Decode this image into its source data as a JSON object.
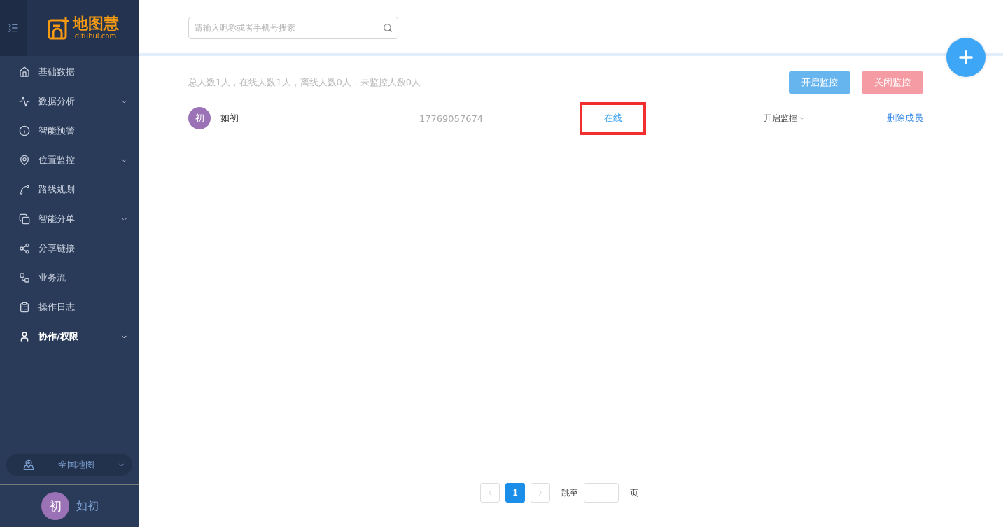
{
  "logo": {
    "name": "地图慧",
    "domain": "dituhui.com"
  },
  "menu": [
    {
      "label": "基础数据",
      "expandable": false,
      "selected": false
    },
    {
      "label": "数据分析",
      "expandable": true,
      "selected": false
    },
    {
      "label": "智能预警",
      "expandable": false,
      "selected": false
    },
    {
      "label": "位置监控",
      "expandable": true,
      "selected": false
    },
    {
      "label": "路线规划",
      "expandable": false,
      "selected": false
    },
    {
      "label": "智能分单",
      "expandable": true,
      "selected": false
    },
    {
      "label": "分享链接",
      "expandable": false,
      "selected": false
    },
    {
      "label": "业务流",
      "expandable": false,
      "selected": false
    },
    {
      "label": "操作日志",
      "expandable": false,
      "selected": false
    },
    {
      "label": "协作/权限",
      "expandable": true,
      "selected": true
    }
  ],
  "map_selector": {
    "label": "全国地图"
  },
  "user": {
    "avatar": "初",
    "name": "如初"
  },
  "search": {
    "placeholder": "请输入昵称或者手机号搜索"
  },
  "summary": "总人数1人，在线人数1人，离线人数0人，未监控人数0人",
  "buttons": [
    {
      "label": "开启监控",
      "kind": "start"
    },
    {
      "label": "关闭监控",
      "kind": "stop"
    }
  ],
  "members": [
    {
      "avatar": "初",
      "name": "如初",
      "phone": "17769057674",
      "status": "在线",
      "highlighted": true,
      "monitor": "开启监控",
      "action": "删除成员"
    }
  ],
  "pagination": {
    "pages": [
      {
        "label": "1",
        "selected": true
      }
    ],
    "jump_label": "跳至",
    "page_unit": "页"
  }
}
